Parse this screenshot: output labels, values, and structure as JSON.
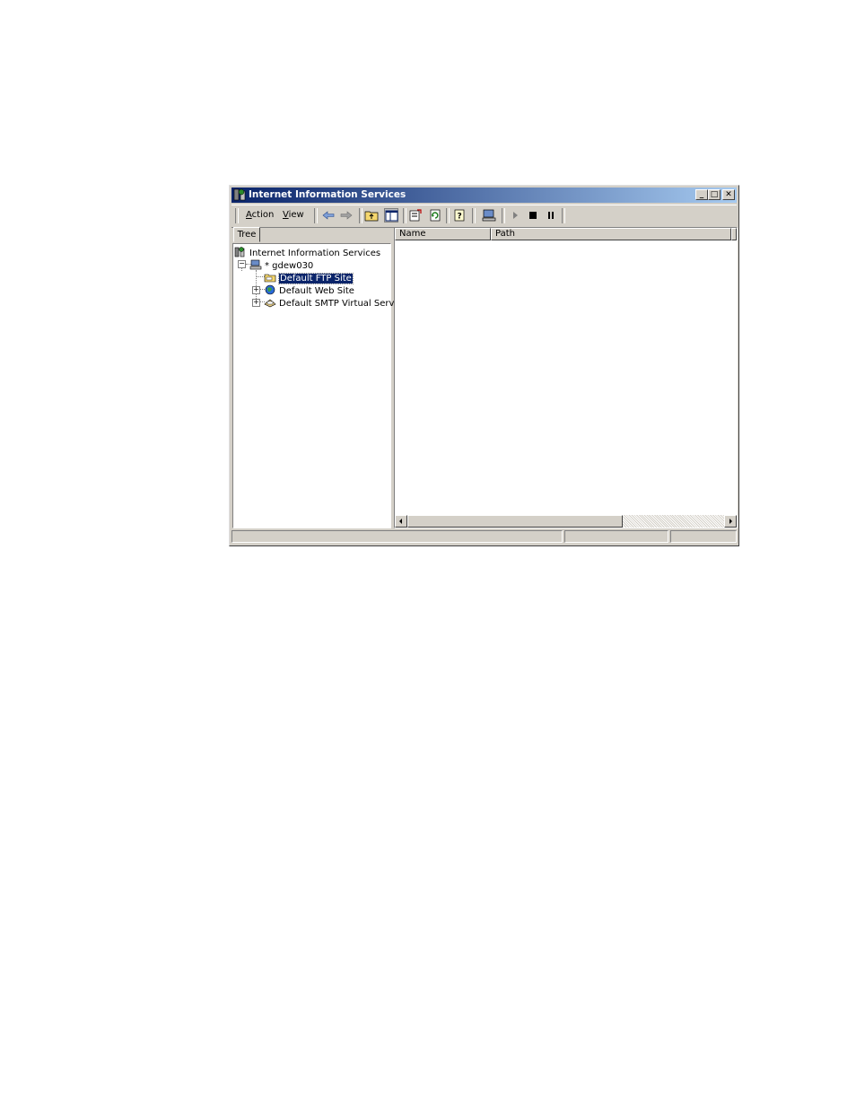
{
  "window": {
    "title": "Internet Information Services"
  },
  "caption_buttons": {
    "minimize": "_",
    "maximize": "□",
    "close": "✕"
  },
  "menu": {
    "action": "Action",
    "action_mnemonic": "A",
    "action_rest": "ction",
    "view": "View",
    "view_mnemonic": "V",
    "view_rest": "iew"
  },
  "toolbar": {
    "icons": [
      "back-arrow-icon",
      "forward-arrow-icon",
      "up-folder-icon",
      "show-hide-tree-icon",
      "properties-icon",
      "refresh-icon",
      "help-icon",
      "computer-icon",
      "play-icon",
      "stop-icon",
      "pause-icon"
    ]
  },
  "tab": {
    "label": "Tree"
  },
  "tree": {
    "root": "Internet Information Services",
    "server": "* gdew030",
    "children": [
      "Default FTP Site",
      "Default Web Site",
      "Default SMTP Virtual Server"
    ],
    "selected": "Default FTP Site"
  },
  "columns": [
    "Name",
    "Path"
  ],
  "colors": {
    "titlebar_start": "#0a246a",
    "titlebar_end": "#a6caf0",
    "selection": "#0a246a",
    "face": "#d4d0c8"
  }
}
